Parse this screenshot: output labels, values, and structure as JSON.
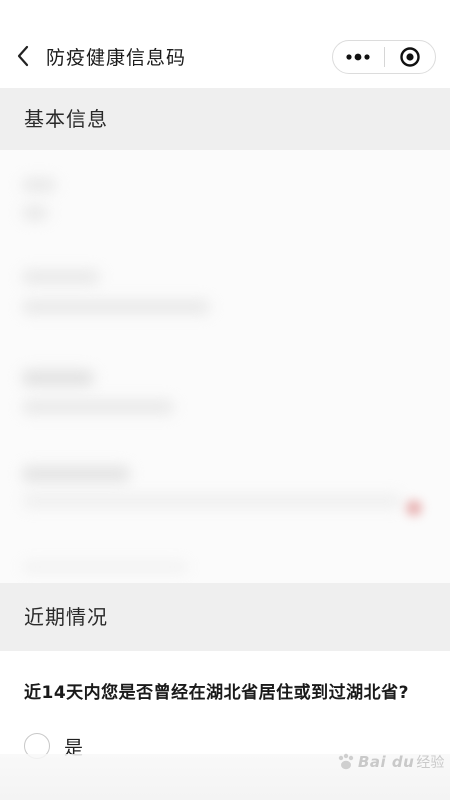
{
  "nav": {
    "title": "防疫健康信息码"
  },
  "sections": {
    "basic_info": "基本信息",
    "recent_status": "近期情况"
  },
  "question": {
    "text": "近14天内您是否曾经在湖北省居住或到过湖北省?",
    "options": [
      {
        "label": "是",
        "selected": false
      }
    ]
  },
  "watermark": {
    "brand": "Bai du",
    "suffix": "经验"
  },
  "colors": {
    "section_bg": "#efefef",
    "page_bg": "#ffffff",
    "text": "#1f1f1f"
  }
}
